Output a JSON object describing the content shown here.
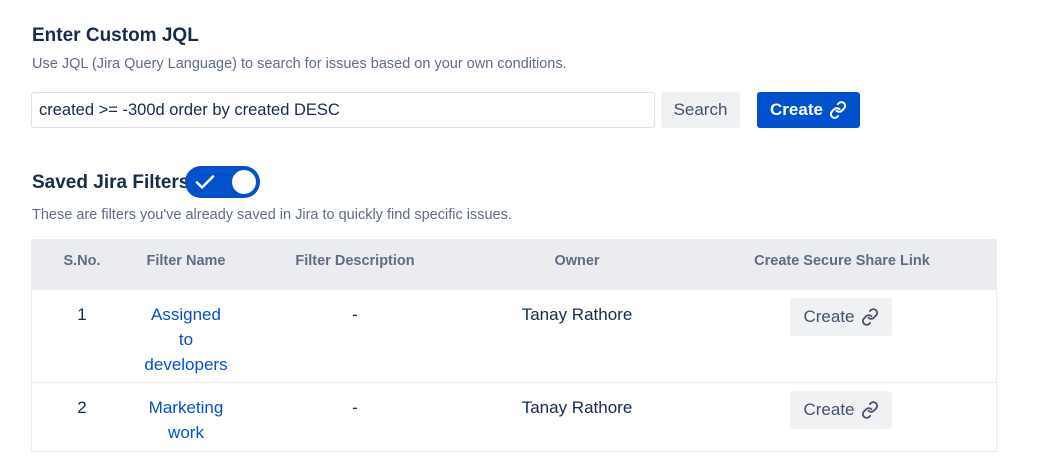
{
  "custom_jql": {
    "title": "Enter Custom JQL",
    "description": "Use JQL (Jira Query Language) to search for issues based on your own conditions.",
    "query_value": "created >= -300d order by created DESC",
    "search_label": "Search",
    "create_label": "Create"
  },
  "saved_filters": {
    "title": "Saved Jira Filters",
    "toggle_on": true,
    "description": "These are filters you've already saved in Jira to quickly find specific issues.",
    "columns": [
      "S.No.",
      "Filter Name",
      "Filter Description",
      "Owner",
      "Create Secure Share Link"
    ],
    "rows": [
      {
        "sno": "1",
        "name_lines": [
          "Assigned",
          "to",
          "developers"
        ],
        "description": "-",
        "owner": "Tanay Rathore",
        "action_label": "Create"
      },
      {
        "sno": "2",
        "name_lines": [
          "Marketing",
          "work"
        ],
        "description": "-",
        "owner": "Tanay Rathore",
        "action_label": "Create"
      }
    ]
  },
  "icons": {
    "create_link": "link-icon",
    "toggle_check": "check-icon"
  },
  "colors": {
    "primary": "#0052cc",
    "text": "#172b4d",
    "subtle_text": "#5e6c84",
    "header_bg": "#ebecf0",
    "secondary_button_bg": "#f0f1f3"
  }
}
